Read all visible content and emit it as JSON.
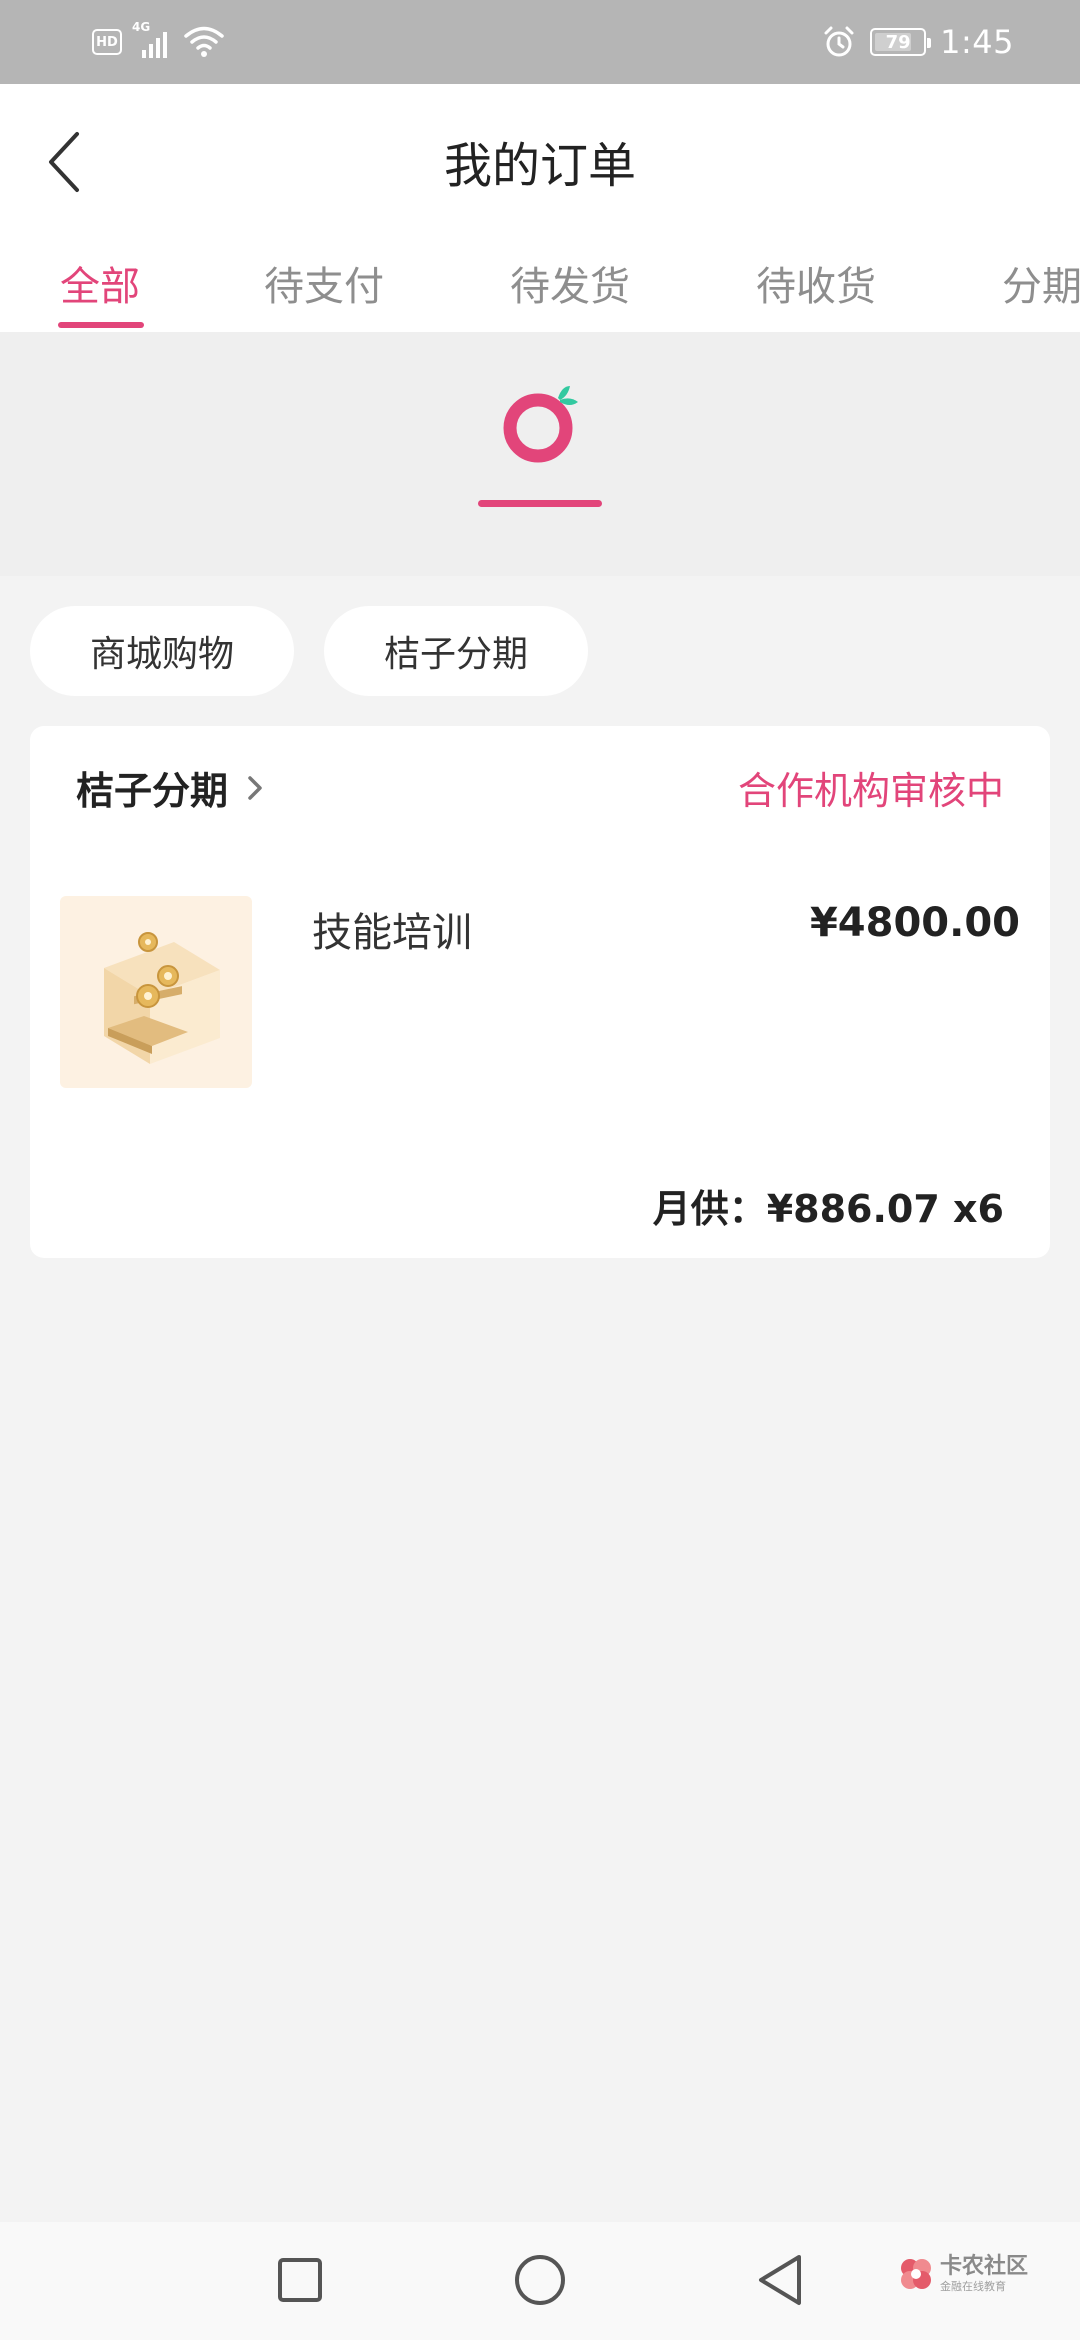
{
  "status_bar": {
    "hd": "HD",
    "network": "4G",
    "battery": "79",
    "battery_level": 0.79,
    "time": "1:45"
  },
  "header": {
    "title": "我的订单",
    "back_icon": "back-arrow-icon"
  },
  "tabs": [
    {
      "label": "全部",
      "active": true
    },
    {
      "label": "待支付",
      "active": false
    },
    {
      "label": "待发货",
      "active": false
    },
    {
      "label": "待收货",
      "active": false
    },
    {
      "label": "分期",
      "active": false
    }
  ],
  "brand": {
    "logo_icon": "orange-logo-icon"
  },
  "filters": [
    {
      "label": "商城购物"
    },
    {
      "label": "桔子分期"
    }
  ],
  "order": {
    "store_name": "桔子分期",
    "status": "合作机构审核中",
    "product": {
      "name": "技能培训",
      "price": "¥4800.00",
      "image_icon": "gold-coin-box-image"
    },
    "installment": "月供：¥886.07 x6"
  },
  "nav_bar": {
    "recents_icon": "square-recents-icon",
    "home_icon": "circle-home-icon",
    "back_icon": "triangle-back-icon"
  },
  "watermark": {
    "title": "卡农社区",
    "subtitle": "金融在线教育"
  },
  "colors": {
    "accent": "#e2457a",
    "brand_leaf": "#33c9a0",
    "status_bar": "#b5b5b5",
    "page_bg": "#f3f3f3"
  }
}
